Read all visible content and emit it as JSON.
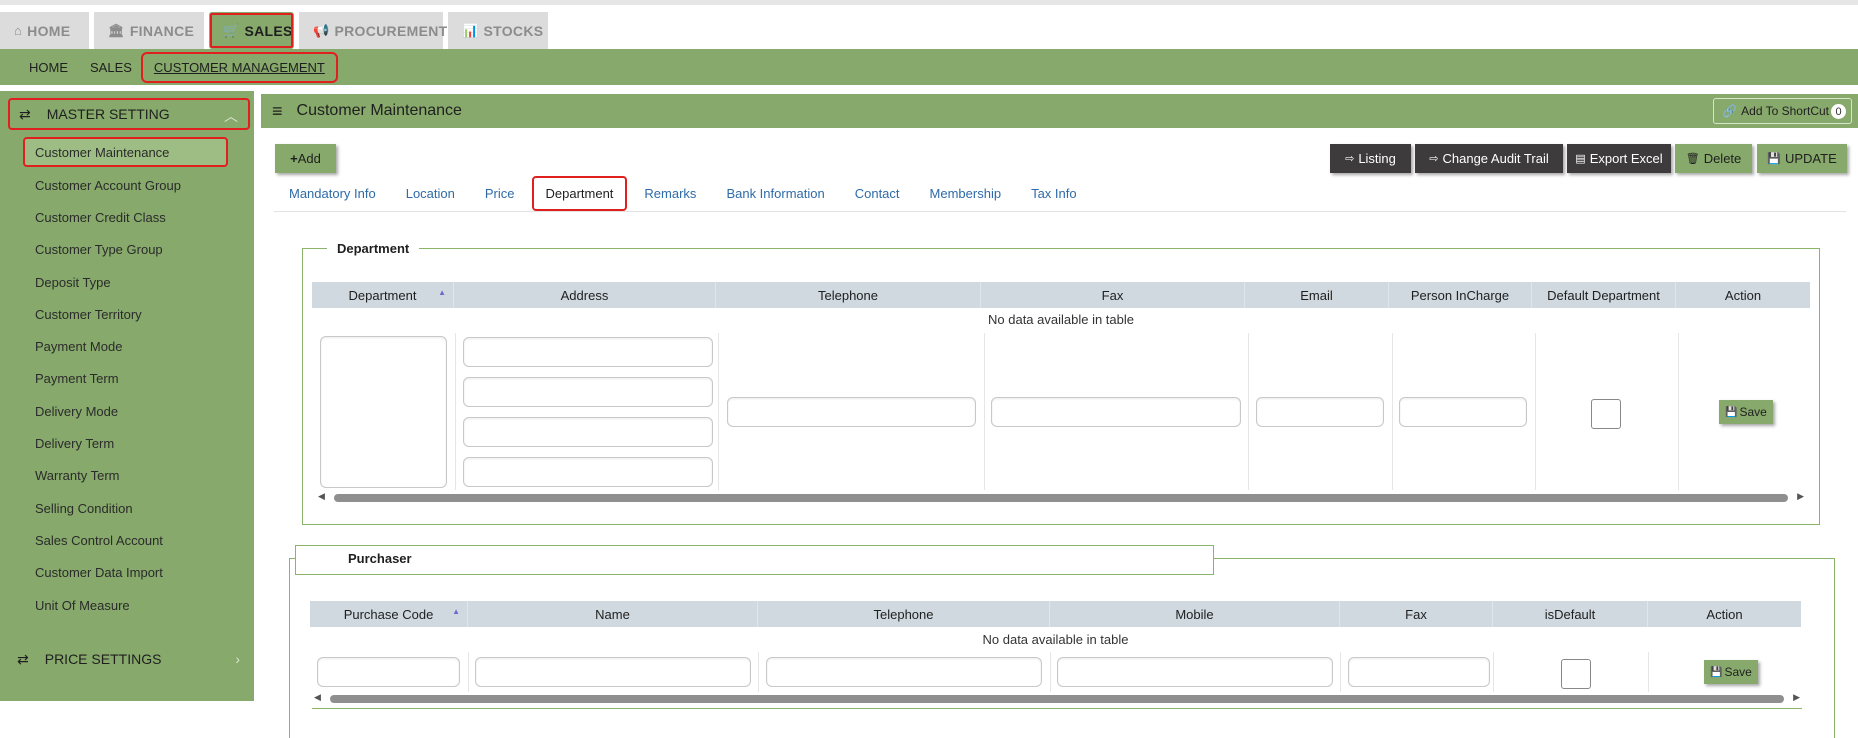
{
  "module_tabs": [
    {
      "label": "HOME",
      "icon": "home-icon"
    },
    {
      "label": "FINANCE",
      "icon": "bank-icon"
    },
    {
      "label": "SALES",
      "icon": "cart-icon"
    },
    {
      "label": "PROCUREMENT",
      "icon": "bullhorn-icon"
    },
    {
      "label": "STOCKS",
      "icon": "chart-icon"
    }
  ],
  "subnav": [
    "HOME",
    "SALES",
    "CUSTOMER MANAGEMENT"
  ],
  "sidebar": {
    "master_label": "MASTER SETTING",
    "items": [
      "Customer Maintenance",
      "Customer Account Group",
      "Customer Credit Class",
      "Customer Type Group",
      "Deposit Type",
      "Customer Territory",
      "Payment Mode",
      "Payment Term",
      "Delivery Mode",
      "Delivery Term",
      "Warranty Term",
      "Selling Condition",
      "Sales Control Account",
      "Customer Data Import",
      "Unit Of Measure"
    ],
    "price_label": "PRICE SETTINGS"
  },
  "header": {
    "title": "Customer Maintenance",
    "shortcut_label": "Add To ShortCut",
    "shortcut_count": "0"
  },
  "toolbar": {
    "add": "Add",
    "listing": "Listing",
    "audit": "Change Audit Trail",
    "export": "Export Excel",
    "delete": "Delete",
    "update": "UPDATE"
  },
  "tabs": [
    "Mandatory Info",
    "Location",
    "Price",
    "Department",
    "Remarks",
    "Bank Information",
    "Contact",
    "Membership",
    "Tax Info"
  ],
  "department": {
    "legend": "Department",
    "columns": [
      "Department",
      "Address",
      "Telephone",
      "Fax",
      "Email",
      "Person InCharge",
      "Default Department",
      "Action"
    ],
    "empty_text": "No data available in table",
    "save_label": "Save"
  },
  "purchaser": {
    "legend": "Purchaser",
    "columns": [
      "Purchase Code",
      "Name",
      "Telephone",
      "Mobile",
      "Fax",
      "isDefault",
      "Action"
    ],
    "empty_text": "No data available in table",
    "save_label": "Save"
  },
  "colors": {
    "accent_green": "#87a96b",
    "highlight_red": "#e0201f",
    "dark_button": "#3d3b3c",
    "link_blue": "#2e6ba8",
    "table_header": "#cfd9df"
  }
}
